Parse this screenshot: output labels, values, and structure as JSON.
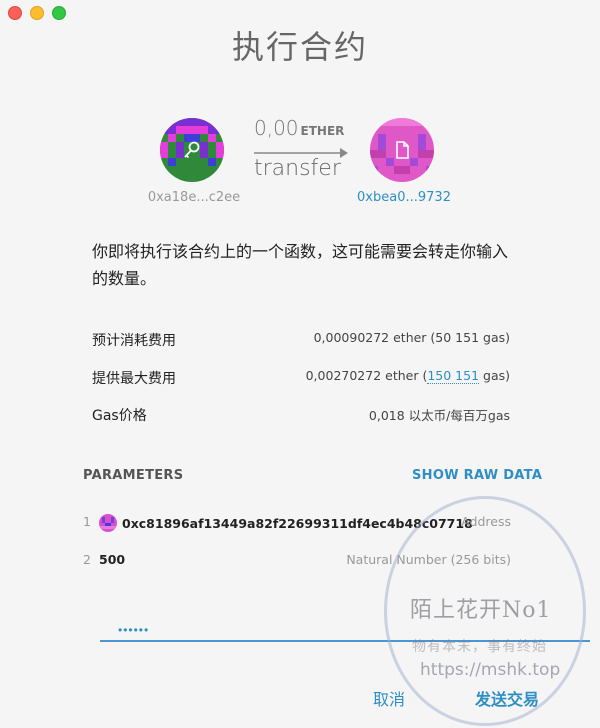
{
  "window": {
    "title": "执行合约"
  },
  "transfer": {
    "from_address": "0xa18e...c2ee",
    "to_address": "0xbea0...9732",
    "amount": "0,00",
    "unit": "ETHER",
    "action_label": "transfer",
    "from_avatar_icon": "key-icon",
    "to_avatar_icon": "document-icon"
  },
  "description": "你即将执行该合约上的一个函数，这可能需要会转走你输入的数量。",
  "fees": {
    "estimated_label": "预计消耗费用",
    "estimated_value": "0,00090272 ether (50 151 gas)",
    "max_label": "提供最大费用",
    "max_value_prefix": "0,00270272 ether (",
    "max_gas_link": "150 151",
    "max_value_suffix": " gas)",
    "gas_price_label": "Gas价格",
    "gas_price_value": "0,018 以太币/每百万gas"
  },
  "parameters": {
    "heading": "PARAMETERS",
    "show_raw_label": "SHOW RAW DATA",
    "items": [
      {
        "index": "1",
        "value": "0xc81896af13449a82f22699311df4ec4b48c07718",
        "type": "Address",
        "icon": "identicon"
      },
      {
        "index": "2",
        "value": "500",
        "type": "Natural Number (256 bits)"
      }
    ]
  },
  "password": {
    "value": "••••••"
  },
  "actions": {
    "cancel_label": "取消",
    "send_label": "发送交易"
  },
  "watermark": {
    "line1": "陌上花开No1",
    "line2": "物有本末，事有终始",
    "line3": "https://mshk.top"
  },
  "colors": {
    "accent": "#2f8fc4",
    "input_underline": "#4a97d6"
  }
}
